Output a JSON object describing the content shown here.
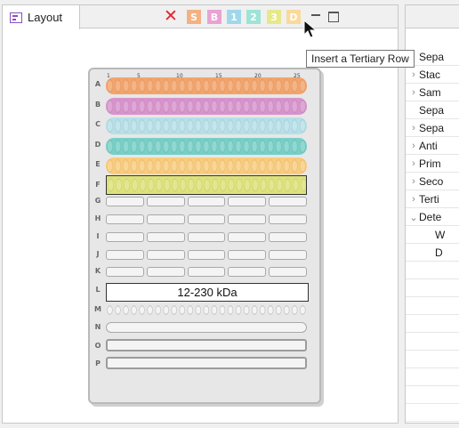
{
  "layout_view": {
    "tab_label": "Layout",
    "toolbar": {
      "delete_icon": "red-x-icon",
      "buttons": [
        {
          "letter": "S",
          "color": "#f4b183"
        },
        {
          "letter": "B",
          "color": "#e9a3d3"
        },
        {
          "letter": "1",
          "color": "#9fd8ea"
        },
        {
          "letter": "2",
          "color": "#9ee4d6"
        },
        {
          "letter": "3",
          "color": "#e6e98a"
        },
        {
          "letter": "D",
          "color": "#fbd99a"
        }
      ]
    },
    "tooltip": "Insert a Tertiary Row",
    "gel": {
      "column_numbers": [
        "1",
        "5",
        "10",
        "15",
        "20",
        "25"
      ],
      "rows": [
        "A",
        "B",
        "C",
        "D",
        "E",
        "F",
        "G",
        "H",
        "I",
        "J",
        "K",
        "L",
        "M",
        "N",
        "O",
        "P"
      ],
      "lane_colors": [
        "#f2a46b",
        "#d794cc",
        "#b6dfe8",
        "#77cfc7",
        "#f9cc7d",
        "#dde27a"
      ],
      "marker_label": "12-230 kDa"
    }
  },
  "tree_view": {
    "rows": [
      {
        "twisty": "",
        "text": "Sepa"
      },
      {
        "twisty": ">",
        "text": "Stac"
      },
      {
        "twisty": ">",
        "text": "Sam"
      },
      {
        "twisty": "",
        "text": "Sepa"
      },
      {
        "twisty": ">",
        "text": "Sepa"
      },
      {
        "twisty": ">",
        "text": "Anti"
      },
      {
        "twisty": ">",
        "text": "Prim"
      },
      {
        "twisty": ">",
        "text": "Seco"
      },
      {
        "twisty": ">",
        "text": "Terti"
      },
      {
        "twisty": "v",
        "text": "Dete"
      },
      {
        "twisty": "",
        "text": "W"
      },
      {
        "twisty": "",
        "text": "D"
      }
    ]
  }
}
